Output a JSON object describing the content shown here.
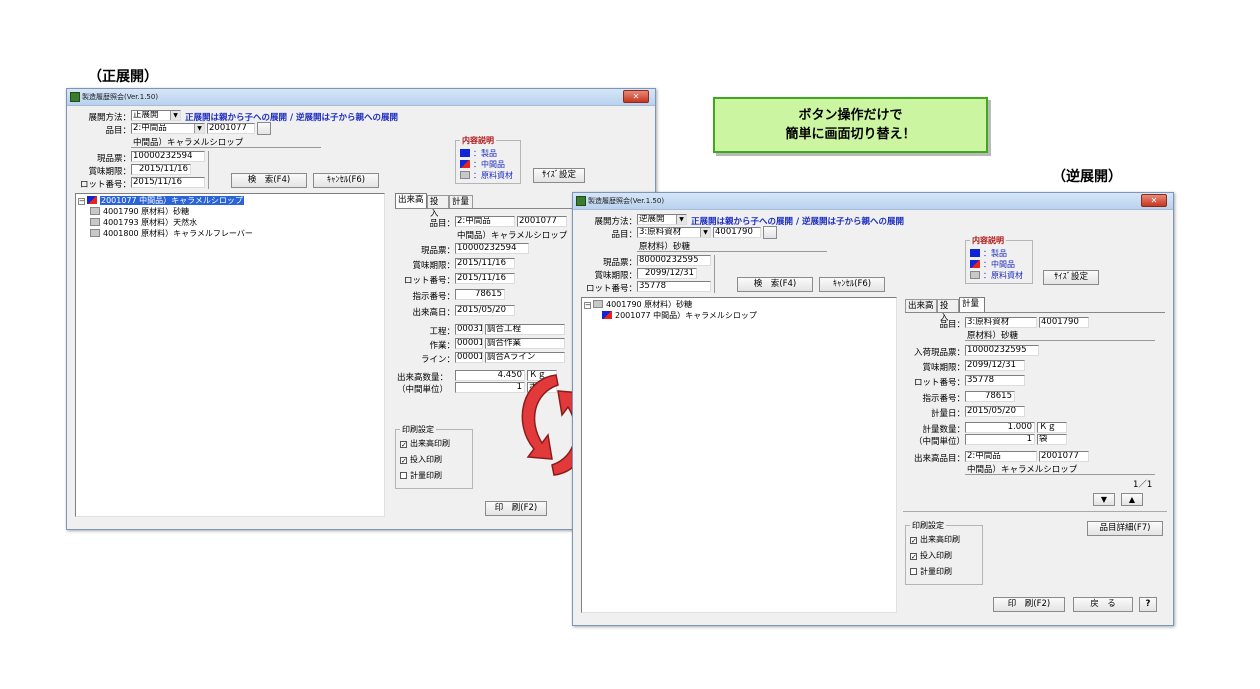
{
  "page": {
    "forward_heading": "（正展開）",
    "reverse_heading": "（逆展開）",
    "callout_line1": "ボタン操作だけで",
    "callout_line2": "簡単に画面切り替え！"
  },
  "win1": {
    "title": "製造履歴照会(Ver.1.50)",
    "method_label": "展開方法：",
    "method_value": "正展開",
    "method_desc": "正展開は親から子への展開 / 逆展開は子から親への展開",
    "item_label": "品目：",
    "item_type": "2:中間品",
    "item_code": "2001077",
    "item_name": "中間品）キャラメルシロップ",
    "lot_slip_label": "現品票：",
    "lot_slip": "10000232594",
    "expiry_label": "賞味期限：",
    "expiry": "2015/11/16",
    "lot_label": "ロット番号：",
    "lot": "2015/11/16",
    "search_btn": "検　索(F4)",
    "cancel_btn": "ｷｬﾝｾﾙ(F6)",
    "size_btn": "ｻｲｽﾞ設定",
    "legend_title": "内容説明",
    "legend": [
      "：製品",
      "：中間品",
      "：原料資材"
    ],
    "tree": [
      "2001077 中間品）キャラメルシロップ",
      "4001790 原材料）砂糖",
      "4001793 原材料）天然水",
      "4001800 原材料）キャラメルフレーバー"
    ],
    "tabs": [
      "出来高",
      "投入",
      "計量"
    ],
    "d_item_label": "品目：",
    "d_item_type": "2:中間品",
    "d_item_code": "2001077",
    "d_item_name": "中間品）キャラメルシロップ",
    "d_slip_label": "現品票：",
    "d_slip": "10000232594",
    "d_expiry_label": "賞味期限：",
    "d_expiry": "2015/11/16",
    "d_lot_label": "ロット番号：",
    "d_lot": "2015/11/16",
    "d_order_label": "指示番号：",
    "d_order": "78615",
    "d_date_label": "出来高日：",
    "d_date": "2015/05/20",
    "d_proc_label": "工程：",
    "d_proc_code": "00031",
    "d_proc_name": "調合工程",
    "d_work_label": "作業：",
    "d_work_code": "00001",
    "d_work_name": "調合作業",
    "d_line_label": "ライン：",
    "d_line_code": "00001",
    "d_line_name": "調合Aライン",
    "d_qty_label": "出来高数量：",
    "d_qty": "4.450",
    "d_qty_unit": "Ｋｇ",
    "d_mid_label": "（中間単位）",
    "d_mid": "1",
    "d_mid_unit": "ボール",
    "print_group": "印刷設定",
    "print_opts": [
      "出来高印刷",
      "投入印刷",
      "計量印刷"
    ],
    "print_btn": "印　刷(F2)"
  },
  "win2": {
    "title": "製造履歴照会(Ver.1.50)",
    "method_label": "展開方法：",
    "method_value": "逆展開",
    "method_desc": "正展開は親から子への展開 / 逆展開は子から親への展開",
    "item_label": "品目：",
    "item_type": "3:原料資材",
    "item_code": "4001790",
    "item_name": "原材料）砂糖",
    "lot_slip_label": "現品票：",
    "lot_slip": "80000232595",
    "expiry_label": "賞味期限：",
    "expiry": "2099/12/31",
    "lot_label": "ロット番号：",
    "lot": "35778",
    "search_btn": "検　索(F4)",
    "cancel_btn": "ｷｬﾝｾﾙ(F6)",
    "size_btn": "ｻｲｽﾞ設定",
    "legend_title": "内容説明",
    "legend": [
      "：製品",
      "：中間品",
      "：原料資材"
    ],
    "tree": [
      "4001790 原材料）砂糖",
      "2001077 中間品）キャラメルシロップ"
    ],
    "tabs": [
      "出来高",
      "投入",
      "計量"
    ],
    "d_item_label": "品目：",
    "d_item_type": "3:原料資材",
    "d_item_code": "4001790",
    "d_item_name": "原材料）砂糖",
    "d_slip_label": "入荷現品票：",
    "d_slip": "10000232595",
    "d_expiry_label": "賞味期限：",
    "d_expiry": "2099/12/31",
    "d_lot_label": "ロット番号：",
    "d_lot": "35778",
    "d_order_label": "指示番号：",
    "d_order": "78615",
    "d_date_label": "計量日：",
    "d_date": "2015/05/20",
    "d_qty_label": "計量数量：",
    "d_qty": "1.000",
    "d_qty_unit": "Ｋｇ",
    "d_mid_label": "（中間単位）",
    "d_mid": "1",
    "d_mid_unit": "袋",
    "d_out_label": "出来高品目：",
    "d_out_type": "2:中間品",
    "d_out_code": "2001077",
    "d_out_name": "中間品）キャラメルシロップ",
    "page_ind": "1／1",
    "down_btn": "▼",
    "up_btn": "▲",
    "detail_btn": "品目詳細(F7)",
    "print_group": "印刷設定",
    "print_opts": [
      "出来高印刷",
      "投入印刷",
      "計量印刷"
    ],
    "print_btn": "印　刷(F2)",
    "back_btn": "戻　る",
    "help_btn": "?"
  }
}
